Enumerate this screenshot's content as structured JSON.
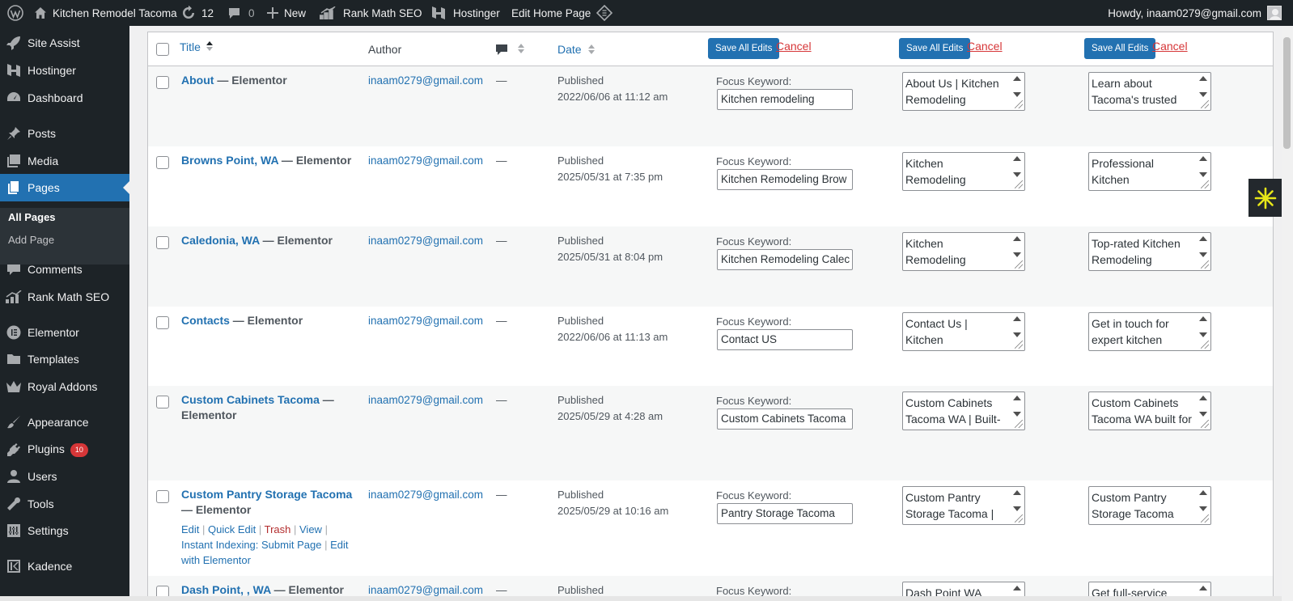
{
  "admin_bar": {
    "site_name": "Kitchen Remodel Tacoma",
    "updates_count": "12",
    "comments_count": "0",
    "new_label": "New",
    "rank_math": "Rank Math SEO",
    "hostinger": "Hostinger",
    "edit_page": "Edit Home Page",
    "howdy": "Howdy, inaam0279@gmail.com"
  },
  "sidebar": {
    "items": [
      {
        "label": "Site Assist",
        "icon": "rocket-icon"
      },
      {
        "label": "Hostinger",
        "icon": "hostinger-icon"
      },
      {
        "label": "Dashboard",
        "icon": "dashboard-icon"
      },
      {
        "label": "Posts",
        "icon": "pin-icon"
      },
      {
        "label": "Media",
        "icon": "media-icon"
      },
      {
        "label": "Pages",
        "icon": "pages-icon"
      },
      {
        "label": "Comments",
        "icon": "comment-icon"
      },
      {
        "label": "Rank Math SEO",
        "icon": "chart-icon"
      },
      {
        "label": "Elementor",
        "icon": "elementor-icon"
      },
      {
        "label": "Templates",
        "icon": "folder-icon"
      },
      {
        "label": "Royal Addons",
        "icon": "crown-icon"
      },
      {
        "label": "Appearance",
        "icon": "brush-icon"
      },
      {
        "label": "Plugins",
        "icon": "plug-icon",
        "badge": "10"
      },
      {
        "label": "Users",
        "icon": "user-icon"
      },
      {
        "label": "Tools",
        "icon": "wrench-icon"
      },
      {
        "label": "Settings",
        "icon": "settings-icon"
      },
      {
        "label": "Kadence",
        "icon": "kadence-icon"
      }
    ],
    "submenu": {
      "all_pages": "All Pages",
      "add_page": "Add Page"
    }
  },
  "table": {
    "headers": {
      "title": "Title",
      "author": "Author",
      "date": "Date",
      "save_all": "Save All Edits",
      "cancel": "Cancel"
    },
    "focus_label": "Focus Keyword:",
    "published": "Published",
    "dash": "—",
    "rows": [
      {
        "title": "About",
        "suffix": " — Elementor",
        "author": "inaam0279@gmail.com",
        "date": "2022/06/06 at 11:12 am",
        "keyword": "Kitchen remodeling",
        "seo_title": "About Us | Kitchen Remodeling Experts",
        "seo_desc": "Learn about Tacoma's trusted"
      },
      {
        "title": "Browns Point, WA",
        "suffix": " — Elementor",
        "author": "inaam0279@gmail.com",
        "date": "2025/05/31 at 7:35 pm",
        "keyword": "Kitchen Remodeling Brow",
        "seo_title": "Kitchen Remodeling Browns Point WA –",
        "seo_desc": "Professional Kitchen Remodeling Browns"
      },
      {
        "title": "Caledonia, WA",
        "suffix": " — Elementor",
        "author": "inaam0279@gmail.com",
        "date": "2025/05/31 at 8:04 pm",
        "keyword": "Kitchen Remodeling Calec",
        "seo_title": "Kitchen Remodeling Caledonia WA –",
        "seo_desc": "Top-rated Kitchen Remodeling"
      },
      {
        "title": "Contacts",
        "suffix": " — Elementor",
        "author": "inaam0279@gmail.com",
        "date": "2022/06/06 at 11:13 am",
        "keyword": "Contact US",
        "seo_title": "Contact Us | Kitchen Remodeling Services",
        "seo_desc": "Get in touch for expert kitchen"
      },
      {
        "title": "Custom Cabinets Tacoma",
        "suffix": " —",
        "suffix2": "Elementor",
        "author": "inaam0279@gmail.com",
        "date": "2025/05/29 at 4:28 am",
        "keyword": "Custom Cabinets Tacoma",
        "seo_title": "Custom Cabinets Tacoma WA | Built-In",
        "seo_desc": "Custom Cabinets Tacoma WA built for"
      },
      {
        "title": "Custom Pantry Storage Tacoma",
        "suffix": "",
        "suffix2": "— Elementor",
        "author": "inaam0279@gmail.com",
        "date": "2025/05/29 at 10:16 am",
        "keyword": "Pantry Storage Tacoma",
        "seo_title": "Custom Pantry Storage Tacoma |",
        "seo_desc": "Custom Pantry Storage Tacoma"
      },
      {
        "title": "Dash Point, , WA",
        "suffix": " — Elementor",
        "author": "inaam0279@gmail.com",
        "date": "",
        "keyword": "",
        "seo_title": "Dash Point WA",
        "seo_desc": "Get full-service"
      }
    ],
    "row_actions": {
      "edit": "Edit",
      "quick_edit": "Quick Edit",
      "trash": "Trash",
      "view": "View",
      "instant": "Instant Indexing: Submit Page",
      "edit_with": "Edit",
      "with_elementor": "with Elementor"
    }
  },
  "colors": {
    "admin_dark": "#1d2327",
    "accent": "#2271b1",
    "danger": "#d63638",
    "widget_yellow": "#e6e619"
  }
}
